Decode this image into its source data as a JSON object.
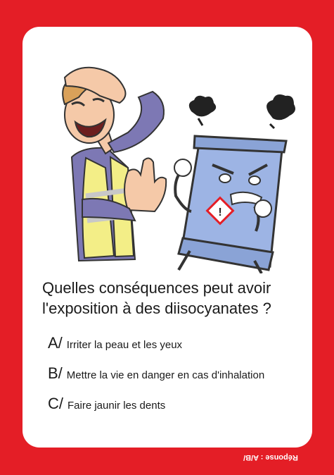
{
  "question": {
    "line1": "Quelles conséquences peut avoir",
    "line2": "l'exposition à des diisocyanates ?"
  },
  "answers": [
    {
      "letter": "A/",
      "text": "Irriter la peau et les yeux"
    },
    {
      "letter": "B/",
      "text": "Mettre la vie en danger en cas d'inhalation"
    },
    {
      "letter": "C/",
      "text": "Faire jaunir les dents"
    }
  ],
  "response": "Réponse : A/B/",
  "colors": {
    "background": "#e41e26",
    "card": "#ffffff",
    "vest": "#f3ee87",
    "barrel": "#9db4e4"
  },
  "illustration": {
    "left": "worker-in-safety-vest-recoiling",
    "right": "angry-chemical-barrel-with-hazard-pictogram"
  }
}
